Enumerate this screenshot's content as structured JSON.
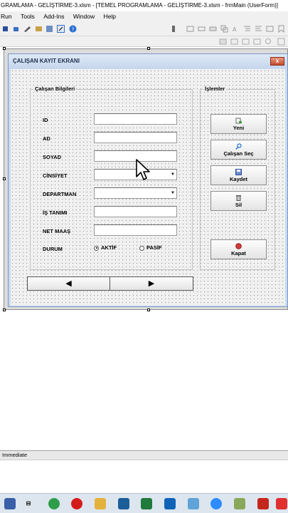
{
  "window": {
    "title": "GRAMLAMA - GELİŞTİRME-3.xlsm - [TEMEL PROGRAMLAMA - GELİŞTİRME-3.xlsm - frmMain (UserForm)]"
  },
  "menu": {
    "items": [
      "Run",
      "Tools",
      "Add-Ins",
      "Window",
      "Help"
    ]
  },
  "form": {
    "title": "ÇALIŞAN KAYIT EKRANI",
    "close_label": "x",
    "frame_employee": {
      "caption": "Çalışan Bilgileri",
      "fields": [
        {
          "label": "ID",
          "kind": "text",
          "value": ""
        },
        {
          "label": "AD",
          "kind": "text",
          "value": ""
        },
        {
          "label": "SOYAD",
          "kind": "text",
          "value": ""
        },
        {
          "label": "CİNSİYET",
          "kind": "combo",
          "value": ""
        },
        {
          "label": "DEPARTMAN",
          "kind": "combo",
          "value": ""
        },
        {
          "label": "İŞ TANIMI",
          "kind": "text",
          "value": ""
        },
        {
          "label": "NET MAAŞ",
          "kind": "text",
          "value": ""
        }
      ],
      "status": {
        "label": "DURUM",
        "options": [
          "AKTİF",
          "PASİF"
        ],
        "selected": "AKTİF"
      }
    },
    "frame_actions": {
      "caption": "İşlemler",
      "buttons": [
        {
          "label": "Yeni",
          "icon": "new-icon"
        },
        {
          "label": "Çalışan Seç",
          "icon": "search-icon"
        },
        {
          "label": "Kaydet",
          "icon": "save-icon"
        },
        {
          "label": "Sil",
          "icon": "delete-icon"
        }
      ],
      "close_button": {
        "label": "Kapat",
        "icon": "close-record-icon"
      }
    },
    "nav": {
      "prev": "◀",
      "next": "▶"
    }
  },
  "immediate": {
    "title": "Immediate"
  },
  "colors": {
    "form_border": "#7a96c0",
    "close_red": "#c44a2c",
    "accent_blue": "#1e6fc8"
  }
}
